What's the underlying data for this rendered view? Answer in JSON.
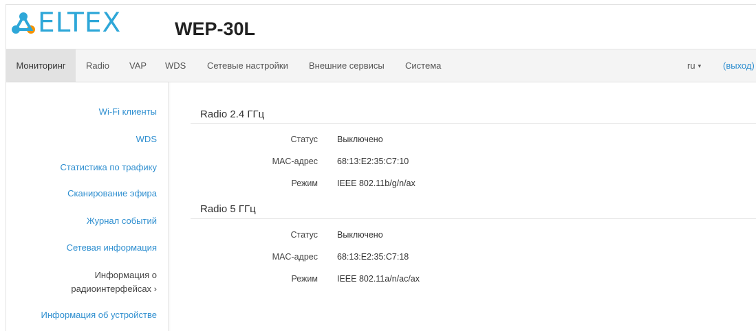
{
  "header": {
    "logo_text": "ELTEX",
    "model": "WEP-30L"
  },
  "nav": {
    "items": [
      {
        "label": "Мониторинг",
        "active": true
      },
      {
        "label": "Radio"
      },
      {
        "label": "VAP"
      },
      {
        "label": "WDS"
      },
      {
        "label": "Сетевые настройки"
      },
      {
        "label": "Внешние сервисы"
      },
      {
        "label": "Система"
      }
    ],
    "language": "ru",
    "language_caret": "▾",
    "logout": "(выход)"
  },
  "sidebar": {
    "items": [
      {
        "label": "Wi-Fi клиенты"
      },
      {
        "label": "WDS"
      },
      {
        "label": "Статистика по трафику"
      },
      {
        "label": "Сканирование эфира"
      },
      {
        "label": "Журнал событий"
      },
      {
        "label": "Сетевая информация"
      },
      {
        "label_line1": "Информация о",
        "label_line2": "радиоинтерфейсах ›",
        "selected": true
      },
      {
        "label": "Информация об устройстве"
      }
    ]
  },
  "sections": [
    {
      "title": "Radio 2.4 ГГц",
      "rows": [
        {
          "label": "Статус",
          "value": "Выключено"
        },
        {
          "label": "MAC-адрес",
          "value": "68:13:E2:35:C7:10"
        },
        {
          "label": "Режим",
          "value": "IEEE 802.11b/g/n/ax"
        }
      ]
    },
    {
      "title": "Radio 5 ГГц",
      "rows": [
        {
          "label": "Статус",
          "value": "Выключено"
        },
        {
          "label": "MAC-адрес",
          "value": "68:13:E2:35:C7:18"
        },
        {
          "label": "Режим",
          "value": "IEEE 802.11a/n/ac/ax"
        }
      ]
    }
  ],
  "colors": {
    "brand": "#2ea7d8",
    "logo_orange": "#f39200",
    "link": "#2f8fd0",
    "nav_bg": "#f4f4f4",
    "nav_active_bg": "#e2e2e2"
  }
}
